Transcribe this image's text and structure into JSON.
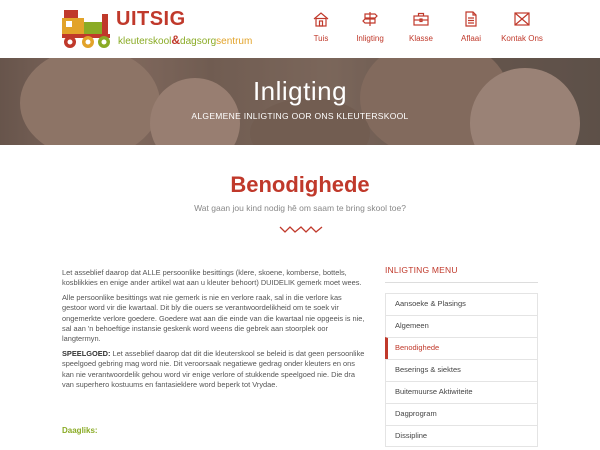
{
  "brand": {
    "name": "UITSIG",
    "sub_a": "kleuterskool",
    "sub_amp": "&",
    "sub_b": "dagsorg",
    "sub_c": "sentrum"
  },
  "nav": [
    {
      "label": "Tuis",
      "icon": "house-icon"
    },
    {
      "label": "Inligting",
      "icon": "signpost-icon"
    },
    {
      "label": "Klasse",
      "icon": "briefcase-icon"
    },
    {
      "label": "Aflaai",
      "icon": "document-icon"
    },
    {
      "label": "Kontak Ons",
      "icon": "envelope-icon"
    }
  ],
  "hero": {
    "title": "Inligting",
    "subtitle": "ALGEMENE INLIGTING OOR ONS KLEUTERSKOOL"
  },
  "section": {
    "title": "Benodighede",
    "subtitle": "Wat gaan jou kind nodig hê om saam te bring skool toe?"
  },
  "content": {
    "p1": "Let asseblief daarop dat ALLE persoonlike besittings (klere, skoene, komberse, bottels, kosblikkies en enige ander artikel wat aan u kleuter behoort) DUIDELIK gemerk moet wees.",
    "p2": "Alle persoonlike besittings wat nie gemerk is nie en verlore raak, sal in die verlore kas gestoor word vir die kwartaal. Dit bly die ouers se verantwoordelikheid om te soek vir ongemerkte verlore goedere. Goedere wat aan die einde van die kwartaal nie opgeeis is nie, sal aan 'n behoeftige instansie geskenk word weens die gebrek aan stoorplek oor langtermyn.",
    "p3_label": "SPEELGOED:",
    "p3": " Let asseblief daarop dat dit die kleuterskool se beleid is dat geen persoonlike speelgoed gebring mag word nie. Dit veroorsaak negatiewe gedrag onder kleuters en ons kan nie verantwoordelik gehou word vir enige verlore of stukkende speelgoed nie. Die dra van superhero kostuums en fantasieklere word beperk tot Vrydae.",
    "daagliks": "Daagliks:"
  },
  "sidebar": {
    "title": "INLIGTING MENU",
    "items": [
      {
        "label": "Aansoeke & Plasings"
      },
      {
        "label": "Algemeen"
      },
      {
        "label": "Benodighede"
      },
      {
        "label": "Beserings & siektes"
      },
      {
        "label": "Buitemuurse Aktiwiteite"
      },
      {
        "label": "Dagprogram"
      },
      {
        "label": "Dissipline"
      }
    ],
    "active_index": 2
  },
  "colors": {
    "accent": "#c0392b",
    "green": "#8aab25",
    "orange": "#e2a32a"
  }
}
